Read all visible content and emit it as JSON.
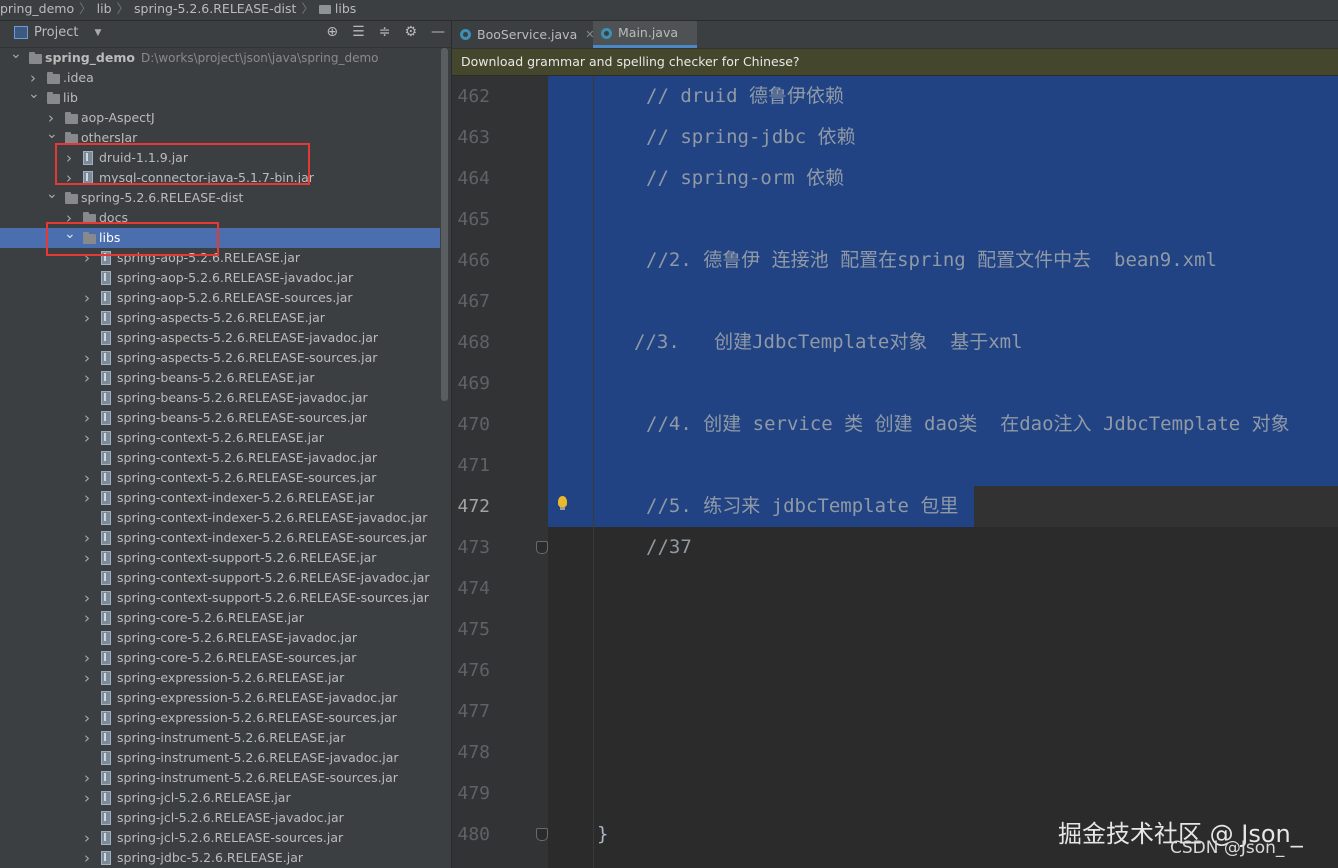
{
  "breadcrumb": {
    "items": [
      "pring_demo",
      "lib",
      "spring-5.2.6.RELEASE-dist",
      "libs"
    ]
  },
  "project_panel": {
    "title": "Project",
    "header_icons": [
      "locate-icon",
      "expand-all-icon",
      "collapse-all-icon",
      "gear-icon",
      "minimize-icon"
    ],
    "tree": [
      {
        "label": "spring_demo",
        "path": "D:\\works\\project\\json\\java\\spring_demo",
        "expanded": true,
        "type": "project"
      },
      {
        "label": ".idea",
        "expanded": false,
        "type": "folder"
      },
      {
        "label": "lib",
        "expanded": true,
        "type": "folder"
      },
      {
        "label": "aop-AspectJ",
        "expanded": false,
        "type": "folder"
      },
      {
        "label": "othersJar",
        "expanded": true,
        "type": "folder"
      },
      {
        "label": "druid-1.1.9.jar",
        "expanded": false,
        "type": "jar"
      },
      {
        "label": "mysql-connector-java-5.1.7-bin.jar",
        "expanded": false,
        "type": "jar"
      },
      {
        "label": "spring-5.2.6.RELEASE-dist",
        "expanded": true,
        "type": "folder"
      },
      {
        "label": "docs",
        "expanded": false,
        "type": "folder"
      },
      {
        "label": "libs",
        "expanded": true,
        "type": "folder",
        "selected": true
      },
      {
        "label": "spring-aop-5.2.6.RELEASE.jar",
        "type": "jar",
        "arrow": true
      },
      {
        "label": "spring-aop-5.2.6.RELEASE-javadoc.jar",
        "type": "jar",
        "arrow": false
      },
      {
        "label": "spring-aop-5.2.6.RELEASE-sources.jar",
        "type": "jar",
        "arrow": true
      },
      {
        "label": "spring-aspects-5.2.6.RELEASE.jar",
        "type": "jar",
        "arrow": true
      },
      {
        "label": "spring-aspects-5.2.6.RELEASE-javadoc.jar",
        "type": "jar",
        "arrow": false
      },
      {
        "label": "spring-aspects-5.2.6.RELEASE-sources.jar",
        "type": "jar",
        "arrow": true
      },
      {
        "label": "spring-beans-5.2.6.RELEASE.jar",
        "type": "jar",
        "arrow": true
      },
      {
        "label": "spring-beans-5.2.6.RELEASE-javadoc.jar",
        "type": "jar",
        "arrow": false
      },
      {
        "label": "spring-beans-5.2.6.RELEASE-sources.jar",
        "type": "jar",
        "arrow": true
      },
      {
        "label": "spring-context-5.2.6.RELEASE.jar",
        "type": "jar",
        "arrow": true
      },
      {
        "label": "spring-context-5.2.6.RELEASE-javadoc.jar",
        "type": "jar",
        "arrow": false
      },
      {
        "label": "spring-context-5.2.6.RELEASE-sources.jar",
        "type": "jar",
        "arrow": true
      },
      {
        "label": "spring-context-indexer-5.2.6.RELEASE.jar",
        "type": "jar",
        "arrow": true
      },
      {
        "label": "spring-context-indexer-5.2.6.RELEASE-javadoc.jar",
        "type": "jar",
        "arrow": false
      },
      {
        "label": "spring-context-indexer-5.2.6.RELEASE-sources.jar",
        "type": "jar",
        "arrow": true
      },
      {
        "label": "spring-context-support-5.2.6.RELEASE.jar",
        "type": "jar",
        "arrow": true
      },
      {
        "label": "spring-context-support-5.2.6.RELEASE-javadoc.jar",
        "type": "jar",
        "arrow": false
      },
      {
        "label": "spring-context-support-5.2.6.RELEASE-sources.jar",
        "type": "jar",
        "arrow": true
      },
      {
        "label": "spring-core-5.2.6.RELEASE.jar",
        "type": "jar",
        "arrow": true
      },
      {
        "label": "spring-core-5.2.6.RELEASE-javadoc.jar",
        "type": "jar",
        "arrow": false
      },
      {
        "label": "spring-core-5.2.6.RELEASE-sources.jar",
        "type": "jar",
        "arrow": true
      },
      {
        "label": "spring-expression-5.2.6.RELEASE.jar",
        "type": "jar",
        "arrow": true
      },
      {
        "label": "spring-expression-5.2.6.RELEASE-javadoc.jar",
        "type": "jar",
        "arrow": false
      },
      {
        "label": "spring-expression-5.2.6.RELEASE-sources.jar",
        "type": "jar",
        "arrow": true
      },
      {
        "label": "spring-instrument-5.2.6.RELEASE.jar",
        "type": "jar",
        "arrow": true
      },
      {
        "label": "spring-instrument-5.2.6.RELEASE-javadoc.jar",
        "type": "jar",
        "arrow": false
      },
      {
        "label": "spring-instrument-5.2.6.RELEASE-sources.jar",
        "type": "jar",
        "arrow": true
      },
      {
        "label": "spring-jcl-5.2.6.RELEASE.jar",
        "type": "jar",
        "arrow": true
      },
      {
        "label": "spring-jcl-5.2.6.RELEASE-javadoc.jar",
        "type": "jar",
        "arrow": false
      },
      {
        "label": "spring-jcl-5.2.6.RELEASE-sources.jar",
        "type": "jar",
        "arrow": true
      },
      {
        "label": "spring-jdbc-5.2.6.RELEASE.jar",
        "type": "jar",
        "arrow": true
      }
    ]
  },
  "editor": {
    "tabs": [
      {
        "label": "BooService.java",
        "active": false
      },
      {
        "label": "Main.java",
        "active": true
      }
    ],
    "notice": "Download grammar and spelling checker for Chinese?",
    "lines": [
      {
        "num": "462",
        "text": "// druid 德鲁伊依赖",
        "selected": true
      },
      {
        "num": "463",
        "text": "// spring-jdbc 依赖",
        "selected": true
      },
      {
        "num": "464",
        "text": "// spring-orm 依赖",
        "selected": true
      },
      {
        "num": "465",
        "text": "",
        "selected": true
      },
      {
        "num": "466",
        "text": "//2. 德鲁伊 连接池 配置在spring 配置文件中去  bean9.xml",
        "selected": true
      },
      {
        "num": "467",
        "text": "",
        "selected": true
      },
      {
        "num": "468",
        "text": "//3.   创建JdbcTemplate对象  基于xml",
        "selected": true
      },
      {
        "num": "469",
        "text": "",
        "selected": true
      },
      {
        "num": "470",
        "text": "//4. 创建 service 类 创建 dao类  在dao注入 JdbcTemplate 对象",
        "selected": true
      },
      {
        "num": "471",
        "text": "",
        "selected": true
      },
      {
        "num": "472",
        "text": "//5. 练习来 jdbcTemplate 包里",
        "selected": "partial",
        "current": true
      },
      {
        "num": "473",
        "text": "//37",
        "selected": false
      },
      {
        "num": "474",
        "text": "",
        "selected": false
      },
      {
        "num": "475",
        "text": "",
        "selected": false
      },
      {
        "num": "476",
        "text": "",
        "selected": false
      },
      {
        "num": "477",
        "text": "",
        "selected": false
      },
      {
        "num": "478",
        "text": "",
        "selected": false
      },
      {
        "num": "479",
        "text": "",
        "selected": false
      },
      {
        "num": "480",
        "text": "}",
        "selected": false
      }
    ]
  },
  "watermark": {
    "line1": "掘金技术社区 @ Json_",
    "line2": "CSDN @Json_"
  },
  "colors": {
    "panel_bg": "#3c3f41",
    "editor_bg": "#2b2b2b",
    "selection": "#214283",
    "tree_selection": "#4b6eaf",
    "comment": "#8f9aa6",
    "highlight_box": "#e53935"
  }
}
